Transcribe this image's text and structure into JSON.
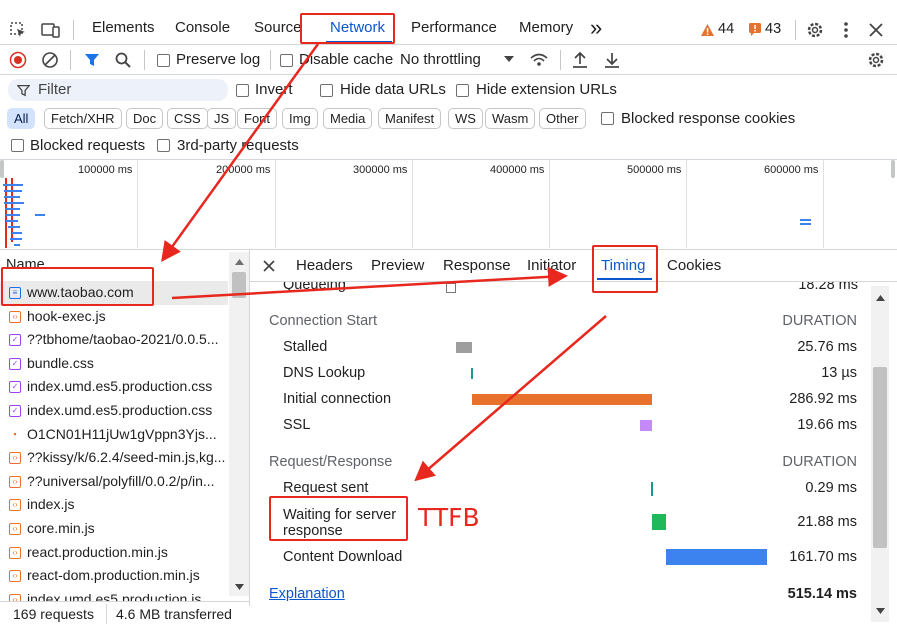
{
  "toolbar": {
    "tabs": [
      "Elements",
      "Console",
      "Sources",
      "Network",
      "Performance",
      "Memory"
    ],
    "more_label": "»",
    "warnings_count": "44",
    "issues_count": "43"
  },
  "network_bar": {
    "preserve_log": "Preserve log",
    "disable_cache": "Disable cache",
    "throttling": "No throttling"
  },
  "filter": {
    "placeholder": "Filter",
    "invert": "Invert",
    "hide_data_urls": "Hide data URLs",
    "hide_extension_urls": "Hide extension URLs"
  },
  "type_chips": [
    "All",
    "Fetch/XHR",
    "Doc",
    "CSS",
    "JS",
    "Font",
    "Img",
    "Media",
    "Manifest",
    "WS",
    "Wasm",
    "Other"
  ],
  "blocked_response_cookies": "Blocked response cookies",
  "blocked_requests": "Blocked requests",
  "third_party_requests": "3rd-party requests",
  "overview": {
    "ticks": [
      "100000 ms",
      "200000 ms",
      "300000 ms",
      "400000 ms",
      "500000 ms",
      "600000 ms"
    ]
  },
  "request_list": {
    "header": "Name",
    "rows": [
      {
        "name": "www.taobao.com",
        "type": "doc"
      },
      {
        "name": "hook-exec.js",
        "type": "js"
      },
      {
        "name": "??tbhome/taobao-2021/0.0.5...",
        "type": "css"
      },
      {
        "name": "bundle.css",
        "type": "css"
      },
      {
        "name": "index.umd.es5.production.css",
        "type": "css"
      },
      {
        "name": "index.umd.es5.production.css",
        "type": "css"
      },
      {
        "name": "O1CN01H11jUw1gVppn3Yjs...",
        "type": "img"
      },
      {
        "name": "??kissy/k/6.2.4/seed-min.js,kg...",
        "type": "js"
      },
      {
        "name": "??universal/polyfill/0.0.2/p/in...",
        "type": "js"
      },
      {
        "name": "index.js",
        "type": "js"
      },
      {
        "name": "core.min.js",
        "type": "js"
      },
      {
        "name": "react.production.min.js",
        "type": "js"
      },
      {
        "name": "react-dom.production.min.js",
        "type": "js"
      },
      {
        "name": "index.umd.es5.production.js",
        "type": "js"
      }
    ]
  },
  "status": {
    "requests": "169 requests",
    "transferred": "4.6 MB transferred"
  },
  "detail_tabs": [
    "Headers",
    "Preview",
    "Response",
    "Initiator",
    "Timing",
    "Cookies"
  ],
  "timing": {
    "queueing_label": "Queueing",
    "queueing_value": "18.28 ms",
    "connection_start": "Connection Start",
    "duration_header": "DURATION",
    "connection_rows": [
      {
        "label": "Stalled",
        "value": "25.76 ms"
      },
      {
        "label": "DNS Lookup",
        "value": "13 µs"
      },
      {
        "label": "Initial connection",
        "value": "286.92 ms"
      },
      {
        "label": "SSL",
        "value": "19.66 ms"
      }
    ],
    "request_response": "Request/Response",
    "request_rows": [
      {
        "label": "Request sent",
        "value": "0.29 ms"
      },
      {
        "label": "Waiting for server response",
        "value": "21.88 ms"
      },
      {
        "label": "Content Download",
        "value": "161.70 ms"
      }
    ],
    "explanation": "Explanation",
    "total": "515.14 ms"
  },
  "annotation": {
    "ttfb": "TTFB"
  },
  "colors": {
    "accent": "#0b57d0",
    "annotation_red": "#e8281f",
    "stalled": "#9e9e9e",
    "connection": "#e8712d",
    "ssl": "#c58af9",
    "waiting": "#1fb85b",
    "download": "#3c83f0"
  }
}
